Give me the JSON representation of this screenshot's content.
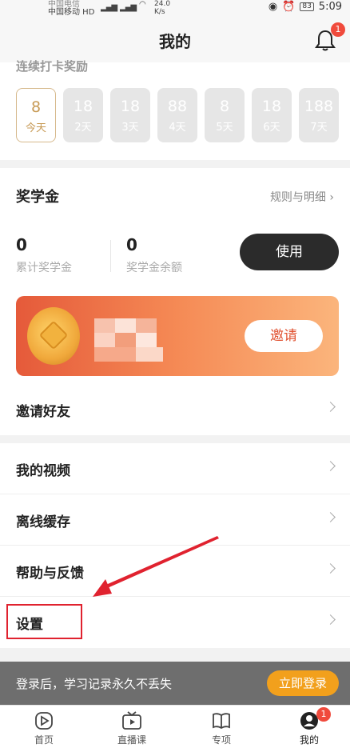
{
  "status_bar": {
    "carrier_top": "中国电信",
    "carrier": "中国移动 HD",
    "signal_1": "4G",
    "signal_2": "4G",
    "net_speed_value": "24.0",
    "net_speed_unit": "K/s",
    "battery": "83",
    "time": "5:09"
  },
  "header": {
    "title": "我的",
    "bell_badge": "1"
  },
  "checkin": {
    "subtitle": "连续打卡奖励",
    "days": [
      {
        "value": "8",
        "label": "今天",
        "today": true
      },
      {
        "value": "18",
        "label": "2天",
        "today": false
      },
      {
        "value": "18",
        "label": "3天",
        "today": false
      },
      {
        "value": "88",
        "label": "4天",
        "today": false
      },
      {
        "value": "8",
        "label": "5天",
        "today": false
      },
      {
        "value": "18",
        "label": "6天",
        "today": false
      },
      {
        "value": "188",
        "label": "7天",
        "today": false
      }
    ]
  },
  "scholarship": {
    "title": "奖学金",
    "rules_link": "规则与明细",
    "total_value": "0",
    "total_label": "累计奖学金",
    "balance_value": "0",
    "balance_label": "奖学金余额",
    "use_button": "使用",
    "invite_button": "邀请"
  },
  "menu": {
    "invite_friends": "邀请好友",
    "my_videos": "我的视频",
    "offline_cache": "离线缓存",
    "help_feedback": "帮助与反馈",
    "settings": "设置"
  },
  "login_bar": {
    "message": "登录后，学习记录永久不丢失",
    "button": "立即登录"
  },
  "tabbar": {
    "home": "首页",
    "live": "直播课",
    "topics": "专项",
    "mine": "我的",
    "mine_badge": "1"
  },
  "colors": {
    "accent": "#f2a01c",
    "annotation_red": "#e0222f",
    "banner_start": "#e55a3a",
    "banner_end": "#fbb57c"
  }
}
